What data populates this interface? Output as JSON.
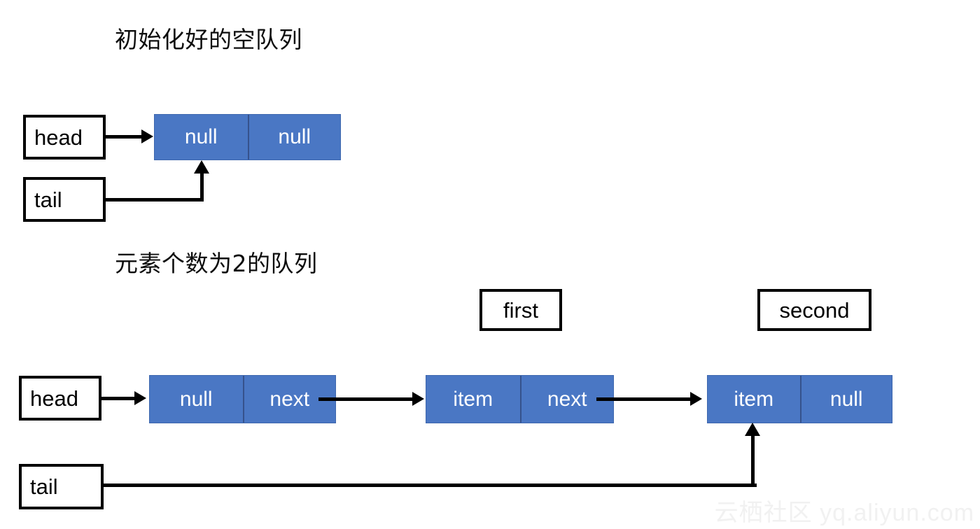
{
  "page": {
    "background_color": "#ffffff",
    "node_fill_color": "#4a77c4",
    "node_text_color": "#ffffff",
    "line_color": "#000000",
    "watermark_color": "#f1f1f1"
  },
  "sections": [
    {
      "title": "初始化好的空队列",
      "pointers": [
        {
          "label": "head"
        },
        {
          "label": "tail"
        }
      ],
      "nodes": [
        {
          "cells": [
            "null",
            "null"
          ]
        }
      ]
    },
    {
      "title": "元素个数为2的队列",
      "pointers": [
        {
          "label": "head"
        },
        {
          "label": "tail"
        },
        {
          "label": "first"
        },
        {
          "label": "second"
        }
      ],
      "nodes": [
        {
          "cells": [
            "null",
            "next"
          ]
        },
        {
          "cells": [
            "item",
            "next"
          ]
        },
        {
          "cells": [
            "item",
            "null"
          ]
        }
      ]
    }
  ],
  "watermark": {
    "cjk": "云栖社区",
    "domain": "yq.aliyun.com"
  }
}
